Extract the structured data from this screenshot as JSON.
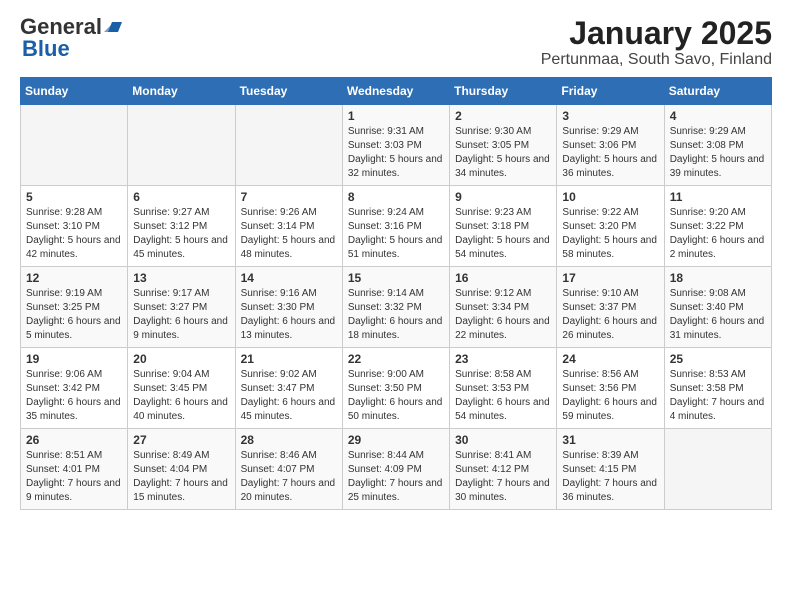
{
  "logo": {
    "general": "General",
    "blue": "Blue"
  },
  "title": "January 2025",
  "subtitle": "Pertunmaa, South Savo, Finland",
  "weekdays": [
    "Sunday",
    "Monday",
    "Tuesday",
    "Wednesday",
    "Thursday",
    "Friday",
    "Saturday"
  ],
  "weeks": [
    [
      {
        "day": "",
        "info": ""
      },
      {
        "day": "",
        "info": ""
      },
      {
        "day": "",
        "info": ""
      },
      {
        "day": "1",
        "info": "Sunrise: 9:31 AM\nSunset: 3:03 PM\nDaylight: 5 hours and 32 minutes."
      },
      {
        "day": "2",
        "info": "Sunrise: 9:30 AM\nSunset: 3:05 PM\nDaylight: 5 hours and 34 minutes."
      },
      {
        "day": "3",
        "info": "Sunrise: 9:29 AM\nSunset: 3:06 PM\nDaylight: 5 hours and 36 minutes."
      },
      {
        "day": "4",
        "info": "Sunrise: 9:29 AM\nSunset: 3:08 PM\nDaylight: 5 hours and 39 minutes."
      }
    ],
    [
      {
        "day": "5",
        "info": "Sunrise: 9:28 AM\nSunset: 3:10 PM\nDaylight: 5 hours and 42 minutes."
      },
      {
        "day": "6",
        "info": "Sunrise: 9:27 AM\nSunset: 3:12 PM\nDaylight: 5 hours and 45 minutes."
      },
      {
        "day": "7",
        "info": "Sunrise: 9:26 AM\nSunset: 3:14 PM\nDaylight: 5 hours and 48 minutes."
      },
      {
        "day": "8",
        "info": "Sunrise: 9:24 AM\nSunset: 3:16 PM\nDaylight: 5 hours and 51 minutes."
      },
      {
        "day": "9",
        "info": "Sunrise: 9:23 AM\nSunset: 3:18 PM\nDaylight: 5 hours and 54 minutes."
      },
      {
        "day": "10",
        "info": "Sunrise: 9:22 AM\nSunset: 3:20 PM\nDaylight: 5 hours and 58 minutes."
      },
      {
        "day": "11",
        "info": "Sunrise: 9:20 AM\nSunset: 3:22 PM\nDaylight: 6 hours and 2 minutes."
      }
    ],
    [
      {
        "day": "12",
        "info": "Sunrise: 9:19 AM\nSunset: 3:25 PM\nDaylight: 6 hours and 5 minutes."
      },
      {
        "day": "13",
        "info": "Sunrise: 9:17 AM\nSunset: 3:27 PM\nDaylight: 6 hours and 9 minutes."
      },
      {
        "day": "14",
        "info": "Sunrise: 9:16 AM\nSunset: 3:30 PM\nDaylight: 6 hours and 13 minutes."
      },
      {
        "day": "15",
        "info": "Sunrise: 9:14 AM\nSunset: 3:32 PM\nDaylight: 6 hours and 18 minutes."
      },
      {
        "day": "16",
        "info": "Sunrise: 9:12 AM\nSunset: 3:34 PM\nDaylight: 6 hours and 22 minutes."
      },
      {
        "day": "17",
        "info": "Sunrise: 9:10 AM\nSunset: 3:37 PM\nDaylight: 6 hours and 26 minutes."
      },
      {
        "day": "18",
        "info": "Sunrise: 9:08 AM\nSunset: 3:40 PM\nDaylight: 6 hours and 31 minutes."
      }
    ],
    [
      {
        "day": "19",
        "info": "Sunrise: 9:06 AM\nSunset: 3:42 PM\nDaylight: 6 hours and 35 minutes."
      },
      {
        "day": "20",
        "info": "Sunrise: 9:04 AM\nSunset: 3:45 PM\nDaylight: 6 hours and 40 minutes."
      },
      {
        "day": "21",
        "info": "Sunrise: 9:02 AM\nSunset: 3:47 PM\nDaylight: 6 hours and 45 minutes."
      },
      {
        "day": "22",
        "info": "Sunrise: 9:00 AM\nSunset: 3:50 PM\nDaylight: 6 hours and 50 minutes."
      },
      {
        "day": "23",
        "info": "Sunrise: 8:58 AM\nSunset: 3:53 PM\nDaylight: 6 hours and 54 minutes."
      },
      {
        "day": "24",
        "info": "Sunrise: 8:56 AM\nSunset: 3:56 PM\nDaylight: 6 hours and 59 minutes."
      },
      {
        "day": "25",
        "info": "Sunrise: 8:53 AM\nSunset: 3:58 PM\nDaylight: 7 hours and 4 minutes."
      }
    ],
    [
      {
        "day": "26",
        "info": "Sunrise: 8:51 AM\nSunset: 4:01 PM\nDaylight: 7 hours and 9 minutes."
      },
      {
        "day": "27",
        "info": "Sunrise: 8:49 AM\nSunset: 4:04 PM\nDaylight: 7 hours and 15 minutes."
      },
      {
        "day": "28",
        "info": "Sunrise: 8:46 AM\nSunset: 4:07 PM\nDaylight: 7 hours and 20 minutes."
      },
      {
        "day": "29",
        "info": "Sunrise: 8:44 AM\nSunset: 4:09 PM\nDaylight: 7 hours and 25 minutes."
      },
      {
        "day": "30",
        "info": "Sunrise: 8:41 AM\nSunset: 4:12 PM\nDaylight: 7 hours and 30 minutes."
      },
      {
        "day": "31",
        "info": "Sunrise: 8:39 AM\nSunset: 4:15 PM\nDaylight: 7 hours and 36 minutes."
      },
      {
        "day": "",
        "info": ""
      }
    ]
  ]
}
